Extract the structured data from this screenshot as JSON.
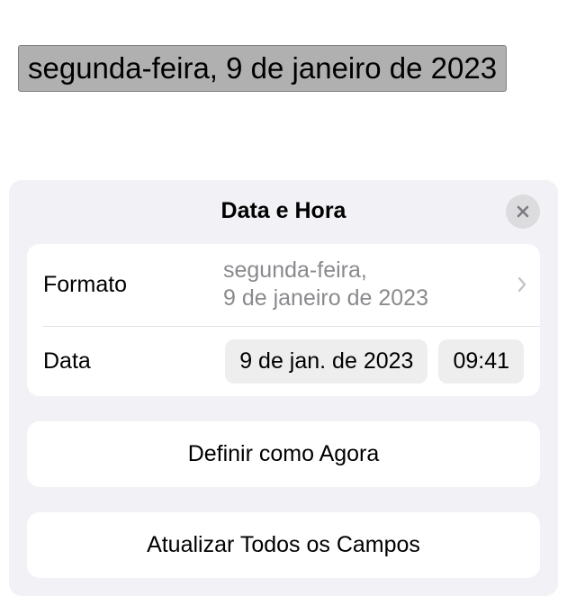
{
  "document": {
    "selected_date_text": "segunda-feira, 9 de janeiro de 2023"
  },
  "panel": {
    "title": "Data e Hora",
    "format": {
      "label": "Formato",
      "value_line1": "segunda-feira,",
      "value_line2": "9 de janeiro de 2023"
    },
    "data": {
      "label": "Data",
      "date_value": "9 de jan. de 2023",
      "time_value": "09:41"
    },
    "buttons": {
      "set_now": "Definir como Agora",
      "update_all": "Atualizar Todos os Campos"
    }
  }
}
